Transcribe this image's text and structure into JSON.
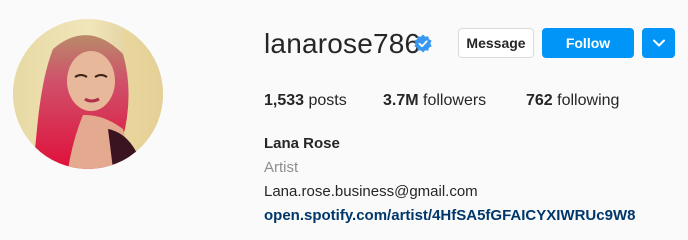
{
  "profile": {
    "username": "lanarose786",
    "verified": true,
    "avatar_icon": "profile-photo",
    "buttons": {
      "message": "Message",
      "follow": "Follow",
      "more_icon": "chevron-down-icon"
    },
    "stats": {
      "posts_count": "1,533",
      "posts_label": "posts",
      "followers_count": "3.7M",
      "followers_label": "followers",
      "following_count": "762",
      "following_label": "following"
    },
    "full_name": "Lana Rose",
    "category": "Artist",
    "email": "Lana.rose.business@gmail.com",
    "link": "open.spotify.com/artist/4HfSA5fGFAICYXIWRUc9W8"
  },
  "colors": {
    "primary_blue": "#0095f6",
    "link_blue": "#00376b",
    "muted": "#8e8e8e",
    "verified_badge": "#3897f0"
  }
}
